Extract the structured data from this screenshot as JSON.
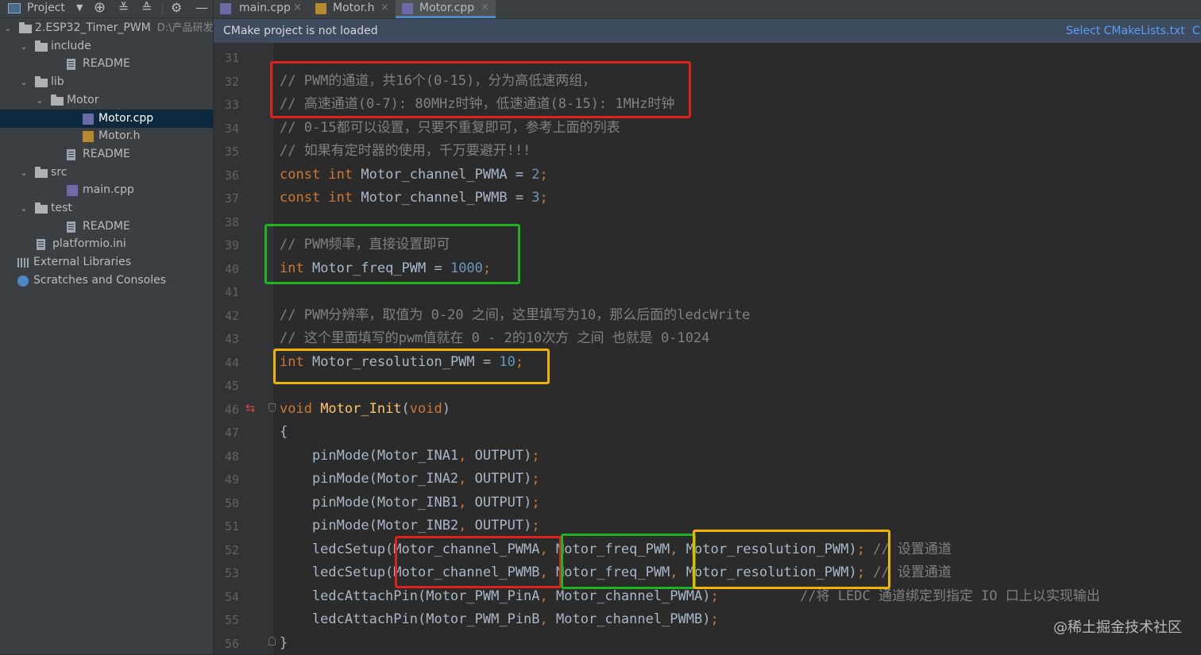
{
  "sidebar": {
    "header_title": "Project",
    "tree": [
      {
        "label": "2.ESP32_Timer_PWM",
        "path": "D:\\产品研发\\",
        "icon": "folder-icon",
        "chevron": "⌄"
      },
      {
        "label": "include",
        "icon": "folder-icon",
        "chevron": "⌄"
      },
      {
        "label": "README",
        "icon": "file-icon",
        "chevron": ""
      },
      {
        "label": "lib",
        "icon": "folder-icon",
        "chevron": "⌄"
      },
      {
        "label": "Motor",
        "icon": "folder-icon",
        "chevron": "⌄"
      },
      {
        "label": "Motor.cpp",
        "icon": "cpp-file-icon",
        "chevron": ""
      },
      {
        "label": "Motor.h",
        "icon": "h-file-icon",
        "chevron": ""
      },
      {
        "label": "README",
        "icon": "file-icon",
        "chevron": ""
      },
      {
        "label": "src",
        "icon": "folder-icon",
        "chevron": "⌄"
      },
      {
        "label": "main.cpp",
        "icon": "cpp-file-icon",
        "chevron": ""
      },
      {
        "label": "test",
        "icon": "folder-icon",
        "chevron": "⌄"
      },
      {
        "label": "README",
        "icon": "file-icon",
        "chevron": ""
      },
      {
        "label": "platformio.ini",
        "icon": "file-icon",
        "chevron": ""
      },
      {
        "label": "External Libraries",
        "icon": "libraries-icon",
        "chevron": ""
      },
      {
        "label": "Scratches and Consoles",
        "icon": "scratches-icon",
        "chevron": ""
      }
    ]
  },
  "tabs": [
    {
      "label": "main.cpp",
      "close": "×"
    },
    {
      "label": "Motor.h",
      "close": "×"
    },
    {
      "label": "Motor.cpp",
      "close": "×"
    }
  ],
  "notification": {
    "message": "CMake project is not loaded",
    "action": "Select CMakeLists.txt",
    "action2": "C"
  },
  "code": {
    "line_numbers": [
      "31",
      "32",
      "33",
      "34",
      "35",
      "36",
      "37",
      "38",
      "39",
      "40",
      "41",
      "42",
      "43",
      "44",
      "45",
      "46",
      "47",
      "48",
      "49",
      "50",
      "51",
      "52",
      "53",
      "54",
      "55",
      "56"
    ],
    "lines": [
      [],
      [
        {
          "t": "// PWM的通道，共16个(0-15)，分为高低速两组，",
          "c": "cmt"
        }
      ],
      [
        {
          "t": "// 高速通道(0-7): 80MHz时钟，低速通道(8-15): 1MHz时钟",
          "c": "cmt"
        }
      ],
      [
        {
          "t": "// 0-15都可以设置，只要不重复即可，参考上面的列表",
          "c": "cmt"
        }
      ],
      [
        {
          "t": "// 如果有定时器的使用，千万要避开!!!",
          "c": "cmt"
        }
      ],
      [
        {
          "t": "const int ",
          "c": "kw"
        },
        {
          "t": "Motor_channel_PWMA = ",
          "c": ""
        },
        {
          "t": "2",
          "c": "num"
        },
        {
          "t": ";",
          "c": "kw"
        }
      ],
      [
        {
          "t": "const int ",
          "c": "kw"
        },
        {
          "t": "Motor_channel_PWMB = ",
          "c": ""
        },
        {
          "t": "3",
          "c": "num"
        },
        {
          "t": ";",
          "c": "kw"
        }
      ],
      [],
      [
        {
          "t": "// PWM频率，直接设置即可",
          "c": "cmt"
        }
      ],
      [
        {
          "t": "int ",
          "c": "kw"
        },
        {
          "t": "Motor_freq_PWM = ",
          "c": ""
        },
        {
          "t": "1000",
          "c": "num"
        },
        {
          "t": ";",
          "c": "kw"
        }
      ],
      [],
      [
        {
          "t": "// PWM分辨率，取值为 0-20 之间，这里填写为10，那么后面的ledcWrite",
          "c": "cmt"
        }
      ],
      [
        {
          "t": "// 这个里面填写的pwm值就在 0 - 2的10次方 之间 也就是 0-1024",
          "c": "cmt"
        }
      ],
      [
        {
          "t": "int ",
          "c": "kw"
        },
        {
          "t": "Motor_resolution_PWM = ",
          "c": ""
        },
        {
          "t": "10",
          "c": "num"
        },
        {
          "t": ";",
          "c": "kw"
        }
      ],
      [],
      [
        {
          "t": "void ",
          "c": "kw"
        },
        {
          "t": "Motor_Init",
          "c": "fn"
        },
        {
          "t": "(",
          "c": ""
        },
        {
          "t": "void",
          "c": "kw"
        },
        {
          "t": ")",
          "c": ""
        }
      ],
      [
        {
          "t": "{",
          "c": ""
        }
      ],
      [
        {
          "t": "    pinMode(Motor_INA1",
          "c": ""
        },
        {
          "t": ", ",
          "c": "kw"
        },
        {
          "t": "OUTPUT)",
          "c": ""
        },
        {
          "t": ";",
          "c": "kw"
        }
      ],
      [
        {
          "t": "    pinMode(Motor_INA2",
          "c": ""
        },
        {
          "t": ", ",
          "c": "kw"
        },
        {
          "t": "OUTPUT)",
          "c": ""
        },
        {
          "t": ";",
          "c": "kw"
        }
      ],
      [
        {
          "t": "    pinMode(Motor_INB1",
          "c": ""
        },
        {
          "t": ", ",
          "c": "kw"
        },
        {
          "t": "OUTPUT)",
          "c": ""
        },
        {
          "t": ";",
          "c": "kw"
        }
      ],
      [
        {
          "t": "    pinMode(Motor_INB2",
          "c": ""
        },
        {
          "t": ", ",
          "c": "kw"
        },
        {
          "t": "OUTPUT)",
          "c": ""
        },
        {
          "t": ";",
          "c": "kw"
        }
      ],
      [
        {
          "t": "    ledcSetup(Motor_channel_PWMA",
          "c": ""
        },
        {
          "t": ", ",
          "c": "kw"
        },
        {
          "t": "Motor_freq_PWM",
          "c": ""
        },
        {
          "t": ", ",
          "c": "kw"
        },
        {
          "t": "Motor_resolution_PWM)",
          "c": ""
        },
        {
          "t": "; ",
          "c": "kw"
        },
        {
          "t": "// 设置通道",
          "c": "cmt"
        }
      ],
      [
        {
          "t": "    ledcSetup(Motor_channel_PWMB",
          "c": ""
        },
        {
          "t": ", ",
          "c": "kw"
        },
        {
          "t": "Motor_freq_PWM",
          "c": ""
        },
        {
          "t": ", ",
          "c": "kw"
        },
        {
          "t": "Motor_resolution_PWM)",
          "c": ""
        },
        {
          "t": "; ",
          "c": "kw"
        },
        {
          "t": "// 设置通道",
          "c": "cmt"
        }
      ],
      [
        {
          "t": "    ledcAttachPin(Motor_PWM_PinA",
          "c": ""
        },
        {
          "t": ", ",
          "c": "kw"
        },
        {
          "t": "Motor_channel_PWMA)",
          "c": ""
        },
        {
          "t": ";          ",
          "c": "kw"
        },
        {
          "t": "//将 LEDC 通道绑定到指定 IO 口上以实现输出",
          "c": "cmt"
        }
      ],
      [
        {
          "t": "    ledcAttachPin(Motor_PWM_PinB",
          "c": ""
        },
        {
          "t": ", ",
          "c": "kw"
        },
        {
          "t": "Motor_channel_PWMB)",
          "c": ""
        },
        {
          "t": ";",
          "c": "kw"
        }
      ],
      [
        {
          "t": "}",
          "c": ""
        }
      ]
    ]
  },
  "watermark": "@稀土掘金技术社区",
  "colors": {
    "accent": "#4a88c7",
    "highlight_red": "#e0201a",
    "highlight_green": "#1fb41f",
    "highlight_yellow": "#f0b400"
  }
}
